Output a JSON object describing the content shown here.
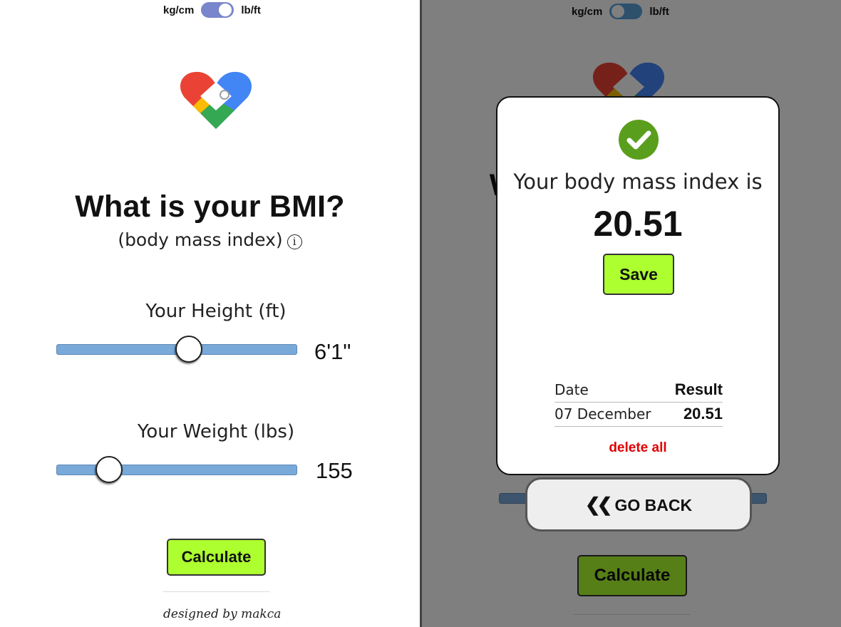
{
  "unit_toggle": {
    "metric_label": "kg/cm",
    "imperial_label": "lb/ft"
  },
  "app": {
    "title": "What is your BMI?",
    "subtitle": "(body mass index)",
    "info_glyph": "i"
  },
  "height": {
    "label": "Your Height (ft)",
    "value": "6'1\"",
    "slider_fraction": 0.55
  },
  "weight": {
    "label": "Your Weight (lbs)",
    "value": "155",
    "slider_fraction": 0.22
  },
  "calculate_label": "Calculate",
  "footer": "designed by makca",
  "result_modal": {
    "heading": "Your body mass index is",
    "bmi": "20.51",
    "save_label": "Save",
    "table": {
      "date_header": "Date",
      "result_header": "Result",
      "rows": [
        {
          "date": "07 December",
          "result": "20.51"
        }
      ]
    },
    "delete_label": "delete all"
  },
  "go_back_label": "GO BACK",
  "colors": {
    "accent_button": "#adff2f",
    "slider_track": "#78a9d9",
    "success": "#5a9e1d",
    "danger": "#e00000"
  }
}
